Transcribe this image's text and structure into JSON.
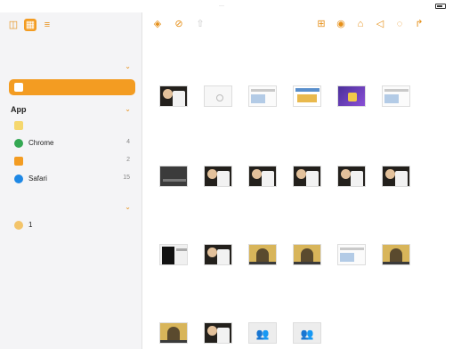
{
  "status_bar": {
    "time_date": "",
    "center": "···",
    "signal": "",
    "battery_icon": "battery-icon"
  },
  "sidebar": {
    "tools": [
      "sidebar-toggle-icon",
      "photos-icon",
      "list-icon"
    ],
    "select_label": "",
    "title": "",
    "section_group": {
      "label": "",
      "expanded": true
    },
    "selected_item": {
      "label": "",
      "count": "",
      "icon": "people-icon"
    },
    "app_section": {
      "label": "App"
    },
    "apps": [
      {
        "label": "",
        "count": "",
        "icon": "notes-app-icon",
        "color": "#f5d76e"
      },
      {
        "label": "Chrome",
        "count": "4",
        "icon": "chrome-icon",
        "color": "#34a853"
      },
      {
        "label": "",
        "count": "2",
        "icon": "home-icon",
        "color": "#f39c22"
      },
      {
        "label": "Safari",
        "count": "15",
        "icon": "safari-icon",
        "color": "#1e88e5"
      }
    ],
    "group_section": {
      "label": ""
    },
    "groups": [
      {
        "label": "1",
        "icon": "person-icon"
      }
    ],
    "bottom_link": ""
  },
  "toolbar": {
    "left_icons": [
      "layers-icon",
      "compass-icon",
      "share-icon"
    ],
    "context_label": "",
    "right_icons": [
      "lock-screen-icon",
      "eye-icon",
      "pin-icon",
      "mute-icon",
      "hide-icon",
      "navigate-icon"
    ]
  },
  "grid": {
    "tiles": [
      {
        "row": 0,
        "col": 0,
        "thumb": "",
        "name": "",
        "meta": ""
      },
      {
        "row": 0,
        "col": 1,
        "thumb": "",
        "name": "",
        "meta": ""
      },
      {
        "row": 0,
        "col": 2,
        "thumb": "",
        "name": "",
        "meta": ""
      },
      {
        "row": 0,
        "col": 3,
        "thumb": "",
        "name": "",
        "meta": ""
      },
      {
        "row": 0,
        "col": 4,
        "thumb": "",
        "name": "",
        "meta": ""
      },
      {
        "row": 0,
        "col": 5,
        "thumb": "",
        "name": "",
        "meta": ""
      },
      {
        "row": 1,
        "col": 0,
        "thumb": "t-video",
        "name": "",
        "meta": ""
      },
      {
        "row": 1,
        "col": 1,
        "thumb": "t-blank",
        "name": "",
        "meta": ""
      },
      {
        "row": 1,
        "col": 2,
        "thumb": "t-screen",
        "name": "",
        "meta": ""
      },
      {
        "row": 1,
        "col": 3,
        "thumb": "t-web",
        "name": "",
        "meta": ""
      },
      {
        "row": 1,
        "col": 4,
        "thumb": "t-purple",
        "name": "",
        "meta": ""
      },
      {
        "row": 1,
        "col": 5,
        "thumb": "t-screen",
        "name": "",
        "meta": ""
      },
      {
        "row": 2,
        "col": 0,
        "thumb": "t-dark",
        "name": "",
        "meta": ""
      },
      {
        "row": 2,
        "col": 1,
        "thumb": "t-video",
        "name": "",
        "meta": ""
      },
      {
        "row": 2,
        "col": 2,
        "thumb": "t-video",
        "name": "",
        "meta": ""
      },
      {
        "row": 2,
        "col": 3,
        "thumb": "t-video",
        "name": "",
        "meta": ""
      },
      {
        "row": 2,
        "col": 4,
        "thumb": "t-video",
        "name": "",
        "meta": ""
      },
      {
        "row": 2,
        "col": 5,
        "thumb": "t-video",
        "name": "",
        "meta": ""
      },
      {
        "row": 3,
        "col": 0,
        "thumb": "t-blackwin",
        "name": "",
        "meta": ""
      },
      {
        "row": 3,
        "col": 1,
        "thumb": "t-video",
        "name": "",
        "meta": ""
      },
      {
        "row": 3,
        "col": 2,
        "thumb": "t-yellow",
        "name": "",
        "meta": ""
      },
      {
        "row": 3,
        "col": 3,
        "thumb": "t-yellow",
        "name": "",
        "meta": ""
      },
      {
        "row": 3,
        "col": 4,
        "thumb": "t-screen",
        "name": "",
        "meta": ""
      },
      {
        "row": 3,
        "col": 5,
        "thumb": "t-yellow",
        "name": "",
        "meta": ""
      },
      {
        "row": 4,
        "col": 0,
        "thumb": "t-yellow",
        "name": "",
        "meta": ""
      },
      {
        "row": 4,
        "col": 1,
        "thumb": "t-video",
        "name": "",
        "meta": ""
      },
      {
        "row": 4,
        "col": 2,
        "thumb": "t-people",
        "name": "",
        "meta": ""
      },
      {
        "row": 4,
        "col": 3,
        "thumb": "t-people",
        "name": "",
        "meta": ""
      }
    ]
  },
  "colors": {
    "accent": "#f39c22",
    "sidebar_bg": "#f4f4f6"
  }
}
